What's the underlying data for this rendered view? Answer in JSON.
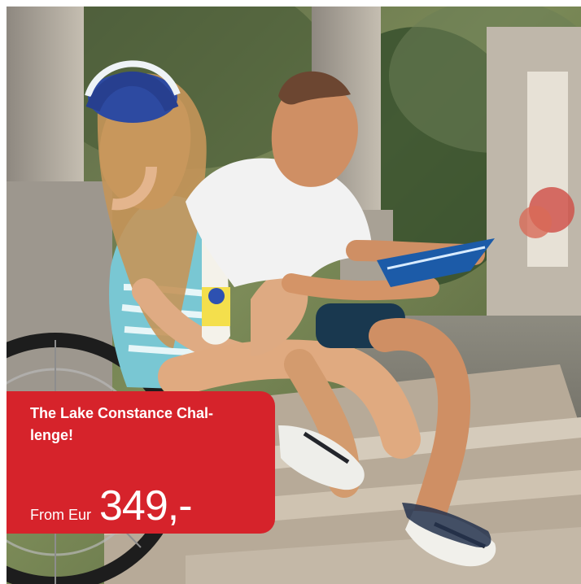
{
  "promo": {
    "title": "The Lake Constance Chal-lenge!",
    "price_prefix": "From Eur",
    "price_value": "349,-"
  },
  "colors": {
    "promo_background": "#d6232b",
    "promo_text": "#ffffff"
  }
}
